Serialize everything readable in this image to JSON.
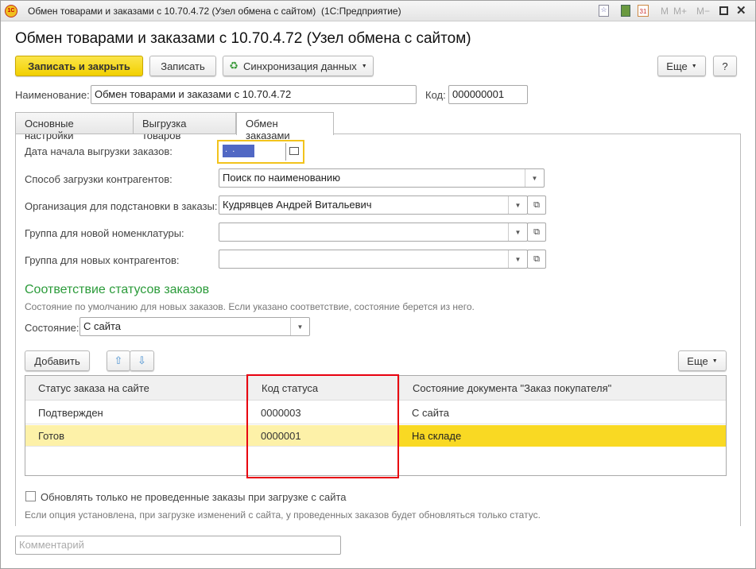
{
  "window": {
    "title": "Обмен товарами и заказами с 10.70.4.72 (Узел обмена с сайтом)  (1С:Предприятие)",
    "buttons": [
      "M",
      "M+",
      "M−"
    ]
  },
  "header": {
    "title": "Обмен товарами и заказами с 10.70.4.72 (Узел обмена с сайтом)"
  },
  "toolbar": {
    "save_close": "Записать и закрыть",
    "save": "Записать",
    "sync": "Синхронизация данных",
    "more": "Еще",
    "help": "?"
  },
  "fields": {
    "name_label": "Наименование:",
    "name_value": "Обмен товарами и заказами с 10.70.4.72",
    "code_label": "Код:",
    "code_value": "000000001"
  },
  "tabs": [
    {
      "label": "Основные настройки"
    },
    {
      "label": "Выгрузка товаров"
    },
    {
      "label": "Обмен заказами",
      "active": true
    }
  ],
  "form": {
    "date_label": "Дата начала выгрузки заказов:",
    "date_value": " .  . ",
    "contractor_label": "Способ загрузки контрагентов:",
    "contractor_value": "Поиск по наименованию",
    "org_label": "Организация для подстановки в заказы:",
    "org_value": "Кудрявцев Андрей Витальевич",
    "nom_group_label": "Группа для новой номенклатуры:",
    "nom_group_value": "",
    "contr_group_label": "Группа для новых контрагентов:",
    "contr_group_value": ""
  },
  "status_section": {
    "title": "Соответствие статусов заказов",
    "hint": "Состояние по умолчанию для новых заказов. Если указано соответствие, состояние берется из него.",
    "state_label": "Состояние:",
    "state_value": "С сайта"
  },
  "table_toolbar": {
    "add": "Добавить",
    "more": "Еще"
  },
  "table": {
    "columns": [
      "Статус заказа на сайте",
      "Код статуса",
      "Состояние документа \"Заказ покупателя\""
    ],
    "rows": [
      [
        "Подтвержден",
        "0000003",
        "С сайта"
      ],
      [
        "Готов",
        "0000001",
        "На складе"
      ]
    ]
  },
  "footer": {
    "checkbox_label": "Обновлять только не проведенные заказы при загрузке с сайта",
    "checkbox_checked": false,
    "note": "Если опция установлена, при загрузке изменений с сайта, у проведенных заказов будет обновляться только статус.",
    "comment_placeholder": "Комментарий"
  },
  "colors": {
    "accent": "#f5d800",
    "green_title": "#2b9b3a",
    "highlight": "#fdf1a8",
    "selected": "#f9d923",
    "annotation": "#e8000f"
  }
}
